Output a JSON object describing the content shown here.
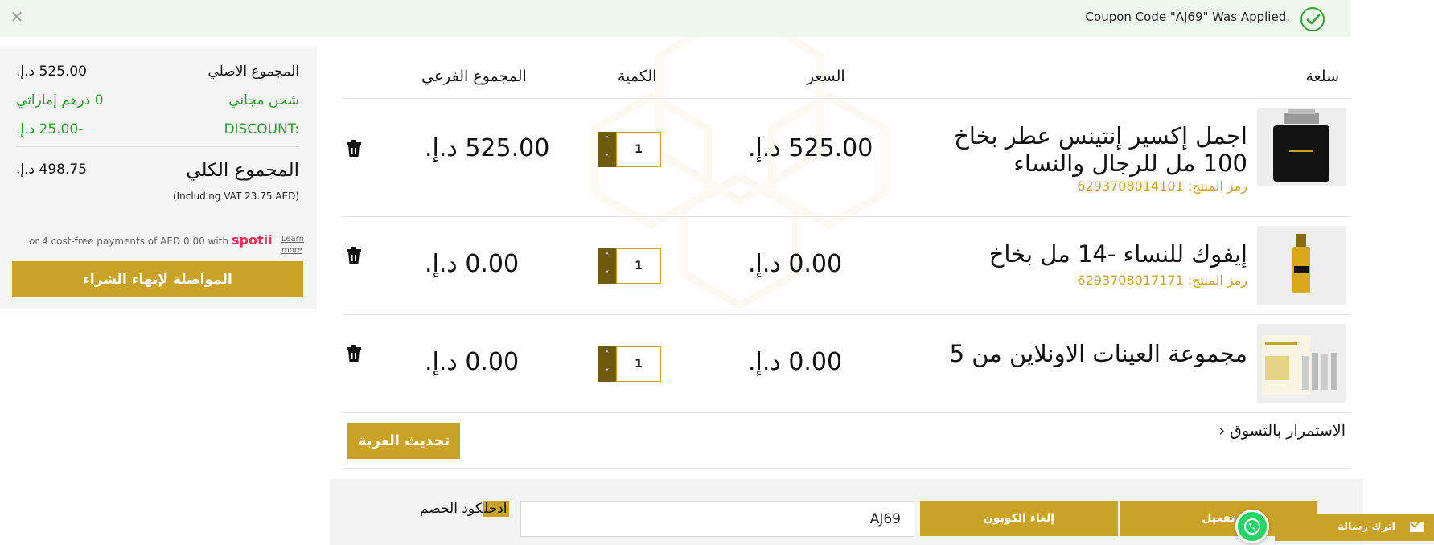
{
  "notice": {
    "message": "Coupon Code \"AJ69\" Was Applied."
  },
  "summary": {
    "original_total_label": "المجموع الاصلي",
    "original_total_value": "525.00 د.إ.",
    "shipping_label": "شحن مجاني",
    "shipping_value": "0 درهم إماراتي",
    "discount_label": "DISCOUNT:",
    "discount_value": "-25.00 د.إ.",
    "grand_total_label": "المجموع الكلي",
    "grand_total_value": "498.75 د.إ.",
    "vat_note": "(Including VAT 23.75 AED)",
    "spotii_text": "or 4 cost-free payments of AED 0.00 with",
    "spotii_logo": "spotii",
    "spotii_learn": "Learn more",
    "checkout_label": "المواصلة لإنهاء الشراء"
  },
  "cart": {
    "headers": {
      "basket": "سلعة",
      "price": "السعر",
      "quantity": "الكمية",
      "subtotal": "المجموع الفرعي"
    },
    "sku_label": "رمز المنتج:",
    "items": [
      {
        "name": "اجمل إكسير إنتينس عطر بخاخ 100 مل للرجال والنساء",
        "sku": "6293708014101",
        "price": "525.00 د.إ.",
        "qty": "1",
        "subtotal": "525.00 د.إ."
      },
      {
        "name": "إيفوك للنساء -14 مل بخاخ",
        "sku": "6293708017171",
        "price": "0.00 د.إ.",
        "qty": "1",
        "subtotal": "0.00 د.إ."
      },
      {
        "name": "مجموعة العينات الاونلاين من 5",
        "sku": "",
        "price": "0.00 د.إ.",
        "qty": "1",
        "subtotal": "0.00 د.إ."
      }
    ],
    "continue_label": "الاستمرار بالتسوق",
    "update_label": "تحديث العربة"
  },
  "coupon": {
    "label_highlight": "ادخل",
    "label_rest": "كود الخصم",
    "value": "AJ69",
    "cancel_label": "إلغاء الكوبون",
    "apply_label": "تفعيل"
  },
  "widgets": {
    "leave_message": "اترك رسالة"
  },
  "colors": {
    "accent": "#c9a227",
    "stepper": "#6f5a12",
    "success": "#2a9d2a",
    "notice_bg": "#eef7ee"
  }
}
